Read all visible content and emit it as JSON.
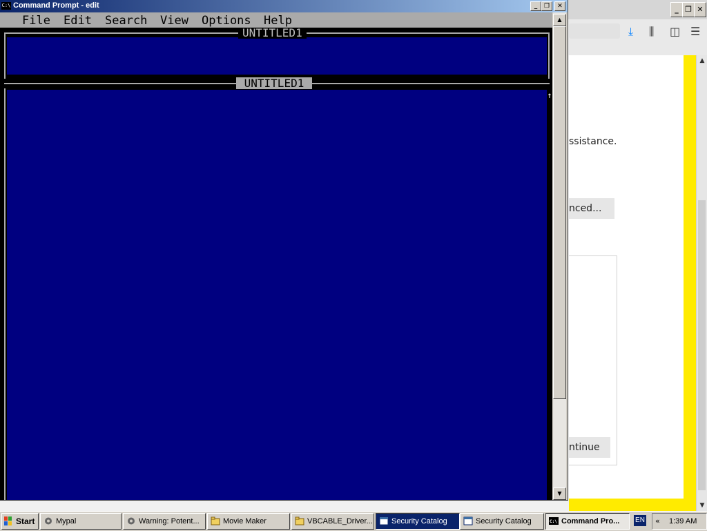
{
  "background_browser": {
    "assist_text": "ssistance.",
    "advanced_button": "nced...",
    "continue_button": "ntinue",
    "window_buttons": [
      "_",
      "❐",
      "✕"
    ]
  },
  "cmd_window": {
    "title": "Command Prompt - edit",
    "icon_text": "C:\\",
    "window_buttons": {
      "minimize": "_",
      "restore": "❐",
      "close": "✕"
    },
    "menu": [
      "File",
      "Edit",
      "Search",
      "View",
      "Options",
      "Help"
    ],
    "pane1_title": "UNTITLED1",
    "pane2_title": "UNTITLED1",
    "scroll_arrow_glyph": "↑"
  },
  "taskbar": {
    "start_label": "Start",
    "tasks": [
      {
        "label": "Mypal",
        "icon": "mypal-icon",
        "active": false
      },
      {
        "label": "Warning: Potent...",
        "icon": "mypal-icon",
        "active": false
      },
      {
        "label": "Movie Maker",
        "icon": "folder-icon",
        "active": false
      },
      {
        "label": "VBCABLE_Driver...",
        "icon": "folder-icon",
        "active": false
      },
      {
        "label": "Security Catalog",
        "icon": "window-icon",
        "active": false,
        "highlight": true
      },
      {
        "label": "Security Catalog",
        "icon": "window-icon",
        "active": false
      },
      {
        "label": "Command Pro...",
        "icon": "cmd-icon",
        "active": true
      }
    ],
    "language": "EN",
    "tray_expand": "«",
    "clock": "1:39 AM"
  },
  "colors": {
    "dos_blue": "#000080",
    "dos_gray": "#aaaaaa",
    "title_gradient_start": "#0a246a",
    "title_gradient_end": "#a6caf0",
    "yellow_frame": "#ffeb00",
    "taskbar": "#d4d0c8"
  }
}
